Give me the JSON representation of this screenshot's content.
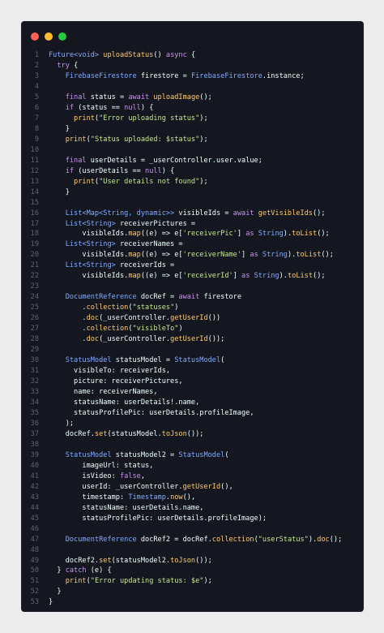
{
  "window": {
    "buttons": [
      {
        "name": "close",
        "color": "#ff5f56"
      },
      {
        "name": "minimize",
        "color": "#ffbd2e"
      },
      {
        "name": "maximize",
        "color": "#27c93f"
      }
    ]
  },
  "colors": {
    "background": "#141720",
    "keyword": "#c792ea",
    "type": "#82aaff",
    "function": "#ffcb6b",
    "string": "#c3e88d",
    "plain": "#eeffff",
    "line_number": "#5c6370"
  },
  "code": {
    "lines": [
      {
        "n": "1",
        "t": [
          [
            "Future<void> ",
            "type"
          ],
          [
            "uploadStatus",
            "fn"
          ],
          [
            "() ",
            ""
          ],
          [
            "async ",
            "kw"
          ],
          [
            "{",
            ""
          ]
        ]
      },
      {
        "n": "2",
        "t": [
          [
            "  ",
            ""
          ],
          [
            "try ",
            "kw"
          ],
          [
            "{",
            ""
          ]
        ]
      },
      {
        "n": "3",
        "t": [
          [
            "    ",
            ""
          ],
          [
            "FirebaseFirestore ",
            "type"
          ],
          [
            "firestore = ",
            ""
          ],
          [
            "FirebaseFirestore",
            "type"
          ],
          [
            ".instance;",
            ""
          ]
        ]
      },
      {
        "n": "4",
        "t": []
      },
      {
        "n": "5",
        "t": [
          [
            "    ",
            ""
          ],
          [
            "final ",
            "kw"
          ],
          [
            "status = ",
            ""
          ],
          [
            "await ",
            "kw"
          ],
          [
            "uploadImage",
            "fn"
          ],
          [
            "();",
            ""
          ]
        ]
      },
      {
        "n": "6",
        "t": [
          [
            "    ",
            ""
          ],
          [
            "if ",
            "kw"
          ],
          [
            "(status == ",
            ""
          ],
          [
            "null",
            "kw"
          ],
          [
            ") {",
            ""
          ]
        ]
      },
      {
        "n": "7",
        "t": [
          [
            "      ",
            ""
          ],
          [
            "print",
            "fn"
          ],
          [
            "(",
            ""
          ],
          [
            "\"Error uploading status\"",
            "str"
          ],
          [
            ");",
            ""
          ]
        ]
      },
      {
        "n": "8",
        "t": [
          [
            "    }",
            ""
          ]
        ]
      },
      {
        "n": "9",
        "t": [
          [
            "    ",
            ""
          ],
          [
            "print",
            "fn"
          ],
          [
            "(",
            ""
          ],
          [
            "\"Status uploaded: $status\"",
            "str"
          ],
          [
            ");",
            ""
          ]
        ]
      },
      {
        "n": "10",
        "t": []
      },
      {
        "n": "11",
        "t": [
          [
            "    ",
            ""
          ],
          [
            "final ",
            "kw"
          ],
          [
            "userDetails = _userController.user.value;",
            ""
          ]
        ]
      },
      {
        "n": "12",
        "t": [
          [
            "    ",
            ""
          ],
          [
            "if ",
            "kw"
          ],
          [
            "(userDetails == ",
            ""
          ],
          [
            "null",
            "kw"
          ],
          [
            ") {",
            ""
          ]
        ]
      },
      {
        "n": "13",
        "t": [
          [
            "      ",
            ""
          ],
          [
            "print",
            "fn"
          ],
          [
            "(",
            ""
          ],
          [
            "\"User details not found\"",
            "str"
          ],
          [
            ");",
            ""
          ]
        ]
      },
      {
        "n": "14",
        "t": [
          [
            "    }",
            ""
          ]
        ]
      },
      {
        "n": "15",
        "t": []
      },
      {
        "n": "16",
        "t": [
          [
            "    ",
            ""
          ],
          [
            "List<Map<String, dynamic>> ",
            "type"
          ],
          [
            "visibleIds = ",
            ""
          ],
          [
            "await ",
            "kw"
          ],
          [
            "getVisibleIds",
            "fn"
          ],
          [
            "();",
            ""
          ]
        ]
      },
      {
        "n": "17",
        "t": [
          [
            "    ",
            ""
          ],
          [
            "List<String> ",
            "type"
          ],
          [
            "receiverPictures =",
            ""
          ]
        ]
      },
      {
        "n": "18",
        "t": [
          [
            "        visibleIds.",
            ""
          ],
          [
            "map",
            "fn"
          ],
          [
            "((e) => e[",
            ""
          ],
          [
            "'receiverPic'",
            "str"
          ],
          [
            "] ",
            ""
          ],
          [
            "as ",
            "kw"
          ],
          [
            "String",
            "type"
          ],
          [
            ").",
            ""
          ],
          [
            "toList",
            "fn"
          ],
          [
            "();",
            ""
          ]
        ]
      },
      {
        "n": "19",
        "t": [
          [
            "    ",
            ""
          ],
          [
            "List<String> ",
            "type"
          ],
          [
            "receiverNames =",
            ""
          ]
        ]
      },
      {
        "n": "20",
        "t": [
          [
            "        visibleIds.",
            ""
          ],
          [
            "map",
            "fn"
          ],
          [
            "((e) => e[",
            ""
          ],
          [
            "'receiverName'",
            "str"
          ],
          [
            "] ",
            ""
          ],
          [
            "as ",
            "kw"
          ],
          [
            "String",
            "type"
          ],
          [
            ").",
            ""
          ],
          [
            "toList",
            "fn"
          ],
          [
            "();",
            ""
          ]
        ]
      },
      {
        "n": "21",
        "t": [
          [
            "    ",
            ""
          ],
          [
            "List<String> ",
            "type"
          ],
          [
            "receiverIds =",
            ""
          ]
        ]
      },
      {
        "n": "22",
        "t": [
          [
            "        visibleIds.",
            ""
          ],
          [
            "map",
            "fn"
          ],
          [
            "((e) => e[",
            ""
          ],
          [
            "'receiverId'",
            "str"
          ],
          [
            "] ",
            ""
          ],
          [
            "as ",
            "kw"
          ],
          [
            "String",
            "type"
          ],
          [
            ").",
            ""
          ],
          [
            "toList",
            "fn"
          ],
          [
            "();",
            ""
          ]
        ]
      },
      {
        "n": "23",
        "t": []
      },
      {
        "n": "24",
        "t": [
          [
            "    ",
            ""
          ],
          [
            "DocumentReference ",
            "type"
          ],
          [
            "docRef = ",
            ""
          ],
          [
            "await ",
            "kw"
          ],
          [
            "firestore",
            ""
          ]
        ]
      },
      {
        "n": "25",
        "t": [
          [
            "        .",
            ""
          ],
          [
            "collection",
            "fn"
          ],
          [
            "(",
            ""
          ],
          [
            "\"statuses\"",
            "str"
          ],
          [
            ")",
            ""
          ]
        ]
      },
      {
        "n": "26",
        "t": [
          [
            "        .",
            ""
          ],
          [
            "doc",
            "fn"
          ],
          [
            "(_userController.",
            ""
          ],
          [
            "getUserId",
            "fn"
          ],
          [
            "())",
            ""
          ]
        ]
      },
      {
        "n": "27",
        "t": [
          [
            "        .",
            ""
          ],
          [
            "collection",
            "fn"
          ],
          [
            "(",
            ""
          ],
          [
            "\"visibleTo\"",
            "str"
          ],
          [
            ")",
            ""
          ]
        ]
      },
      {
        "n": "28",
        "t": [
          [
            "        .",
            ""
          ],
          [
            "doc",
            "fn"
          ],
          [
            "(_userController.",
            ""
          ],
          [
            "getUserId",
            "fn"
          ],
          [
            "());",
            ""
          ]
        ]
      },
      {
        "n": "29",
        "t": []
      },
      {
        "n": "30",
        "t": [
          [
            "    ",
            ""
          ],
          [
            "StatusModel ",
            "type"
          ],
          [
            "statusModel = ",
            ""
          ],
          [
            "StatusModel",
            "type"
          ],
          [
            "(",
            ""
          ]
        ]
      },
      {
        "n": "31",
        "t": [
          [
            "      visibleTo: receiverIds,",
            ""
          ]
        ]
      },
      {
        "n": "32",
        "t": [
          [
            "      picture: receiverPictures,",
            ""
          ]
        ]
      },
      {
        "n": "33",
        "t": [
          [
            "      name: receiverNames,",
            ""
          ]
        ]
      },
      {
        "n": "34",
        "t": [
          [
            "      statusName: userDetails!.name,",
            ""
          ]
        ]
      },
      {
        "n": "35",
        "t": [
          [
            "      statusProfilePic: userDetails.profileImage,",
            ""
          ]
        ]
      },
      {
        "n": "36",
        "t": [
          [
            "    );",
            ""
          ]
        ]
      },
      {
        "n": "37",
        "t": [
          [
            "    docRef.",
            ""
          ],
          [
            "set",
            "fn"
          ],
          [
            "(statusModel.",
            ""
          ],
          [
            "toJson",
            "fn"
          ],
          [
            "());",
            ""
          ]
        ]
      },
      {
        "n": "38",
        "t": []
      },
      {
        "n": "39",
        "t": [
          [
            "    ",
            ""
          ],
          [
            "StatusModel ",
            "type"
          ],
          [
            "statusModel2 = ",
            ""
          ],
          [
            "StatusModel",
            "type"
          ],
          [
            "(",
            ""
          ]
        ]
      },
      {
        "n": "40",
        "t": [
          [
            "        imageUrl: status,",
            ""
          ]
        ]
      },
      {
        "n": "41",
        "t": [
          [
            "        isVideo: ",
            ""
          ],
          [
            "false",
            "kw"
          ],
          [
            ",",
            ""
          ]
        ]
      },
      {
        "n": "42",
        "t": [
          [
            "        userId: _userController.",
            ""
          ],
          [
            "getUserId",
            "fn"
          ],
          [
            "(),",
            ""
          ]
        ]
      },
      {
        "n": "43",
        "t": [
          [
            "        timestamp: ",
            ""
          ],
          [
            "Timestamp",
            "type"
          ],
          [
            ".",
            ""
          ],
          [
            "now",
            "fn"
          ],
          [
            "(),",
            ""
          ]
        ]
      },
      {
        "n": "44",
        "t": [
          [
            "        statusName: userDetails.name,",
            ""
          ]
        ]
      },
      {
        "n": "45",
        "t": [
          [
            "        statusProfilePic: userDetails.profileImage);",
            ""
          ]
        ]
      },
      {
        "n": "46",
        "t": []
      },
      {
        "n": "47",
        "t": [
          [
            "    ",
            ""
          ],
          [
            "DocumentReference ",
            "type"
          ],
          [
            "docRef2 = docRef.",
            ""
          ],
          [
            "collection",
            "fn"
          ],
          [
            "(",
            ""
          ],
          [
            "\"userStatus\"",
            "str"
          ],
          [
            ").",
            ""
          ],
          [
            "doc",
            "fn"
          ],
          [
            "();",
            ""
          ]
        ]
      },
      {
        "n": "48",
        "t": []
      },
      {
        "n": "49",
        "t": [
          [
            "    docRef2.",
            ""
          ],
          [
            "set",
            "fn"
          ],
          [
            "(statusModel2.",
            ""
          ],
          [
            "toJson",
            "fn"
          ],
          [
            "());",
            ""
          ]
        ]
      },
      {
        "n": "50",
        "t": [
          [
            "  } ",
            ""
          ],
          [
            "catch ",
            "kw"
          ],
          [
            "(e) {",
            ""
          ]
        ]
      },
      {
        "n": "51",
        "t": [
          [
            "    ",
            ""
          ],
          [
            "print",
            "fn"
          ],
          [
            "(",
            ""
          ],
          [
            "\"Error updating status: $e\"",
            "str"
          ],
          [
            ");",
            ""
          ]
        ]
      },
      {
        "n": "52",
        "t": [
          [
            "  }",
            ""
          ]
        ]
      },
      {
        "n": "53",
        "t": [
          [
            "}",
            ""
          ]
        ]
      }
    ]
  }
}
